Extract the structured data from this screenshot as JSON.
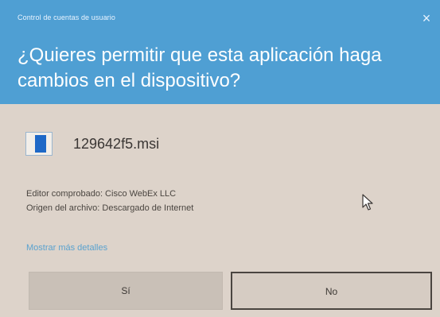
{
  "colors": {
    "header_bg": "#4f9fd3",
    "body_bg": "#ddd3ca",
    "link": "#5aa2cf",
    "file_icon_accent": "#1e68c7"
  },
  "header": {
    "caption": "Control de cuentas de usuario",
    "close_glyph": "×",
    "question": "¿Quieres permitir que esta aplicación haga cambios en el dispositivo?"
  },
  "file": {
    "icon": "installer-file-icon",
    "name": "129642f5.msi"
  },
  "publisher": {
    "verified_line": "Editor comprobado: Cisco WebEx LLC",
    "origin_line": "Origen del archivo: Descargado de Internet"
  },
  "details_link": "Mostrar más detalles",
  "buttons": {
    "yes_label": "Sí",
    "no_label": "No"
  },
  "cursor": {
    "icon": "mouse-pointer-icon"
  }
}
